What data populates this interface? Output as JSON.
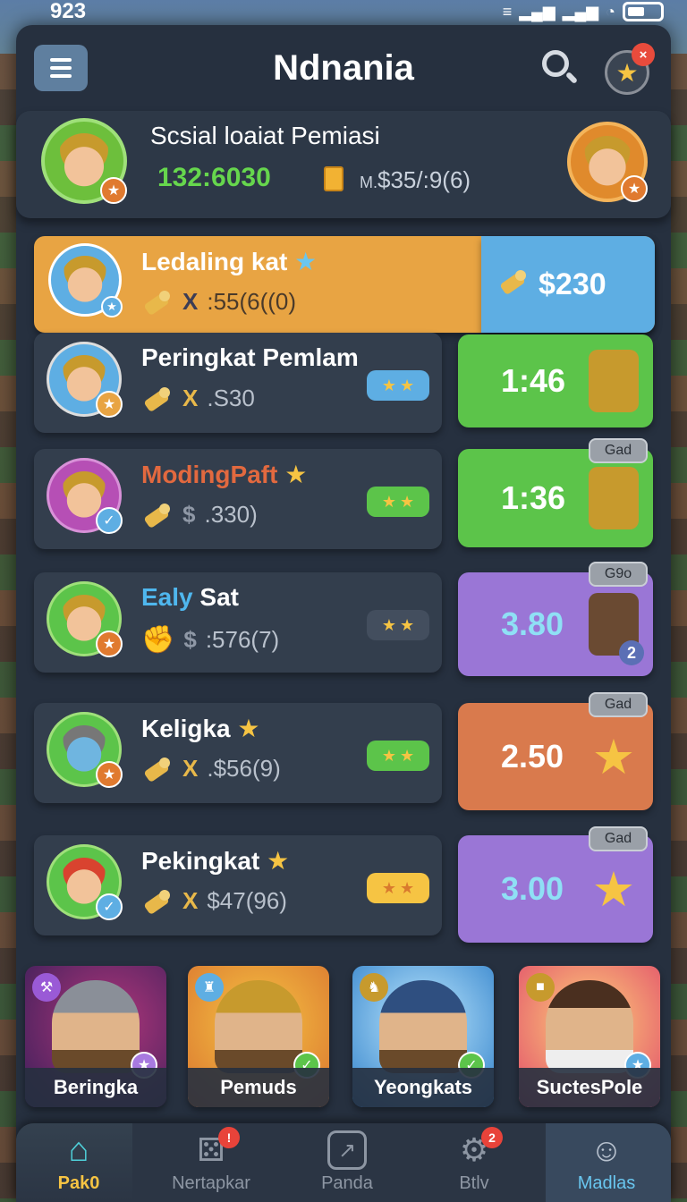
{
  "status_bar": {
    "time": "923"
  },
  "header": {
    "title": "Ndnania",
    "fav_badge": "×"
  },
  "profile": {
    "title": "Scsial loaiat Pemiasi",
    "score": "132:6030",
    "money_prefix": "M.",
    "money": "$35/:9(6)"
  },
  "rows": [
    {
      "name": "Ledaling kat",
      "sub": ":55(6((0)",
      "mult": "X",
      "prize": "$230",
      "highlight": true
    },
    {
      "name": "Peringkat Pemlam",
      "sub": ".S30",
      "mult": "X",
      "prize": "1:46",
      "gad": ""
    },
    {
      "name": "ModingPaft",
      "sub": ".330)",
      "mult": "$",
      "prize": "1:36",
      "gad": "Gad"
    },
    {
      "name_a": "Ealy",
      "name_b": "Sat",
      "sub": ":576(7)",
      "mult": "$",
      "prize": "3.80",
      "gad": "G9o",
      "prize_badge": "2"
    },
    {
      "name": "Keligka",
      "sub": ".$56(9)",
      "mult": "X",
      "prize": "2.50",
      "gad": "Gad"
    },
    {
      "name": "Pekingkat",
      "sub": "$47(96)",
      "mult": "X",
      "prize": "3.00",
      "gad": "Gad"
    }
  ],
  "cards": [
    {
      "label": "Beringka"
    },
    {
      "label": "Pemuds"
    },
    {
      "label": "Yeongkats"
    },
    {
      "label": "SuctesPole"
    }
  ],
  "nav": [
    {
      "label": "Pak0"
    },
    {
      "label": "Nertapkar",
      "badge": "!"
    },
    {
      "label": "Panda"
    },
    {
      "label": "Btlv",
      "badge": "2"
    },
    {
      "label": "Madlas"
    }
  ],
  "colors": {
    "highlight_row": "#e8a443",
    "prize_green": "#5cc44a",
    "prize_purple": "#9a76d6",
    "prize_orange": "#d97a4d",
    "prize_blue": "#5eaee3",
    "accent_yellow": "#f6c443"
  }
}
